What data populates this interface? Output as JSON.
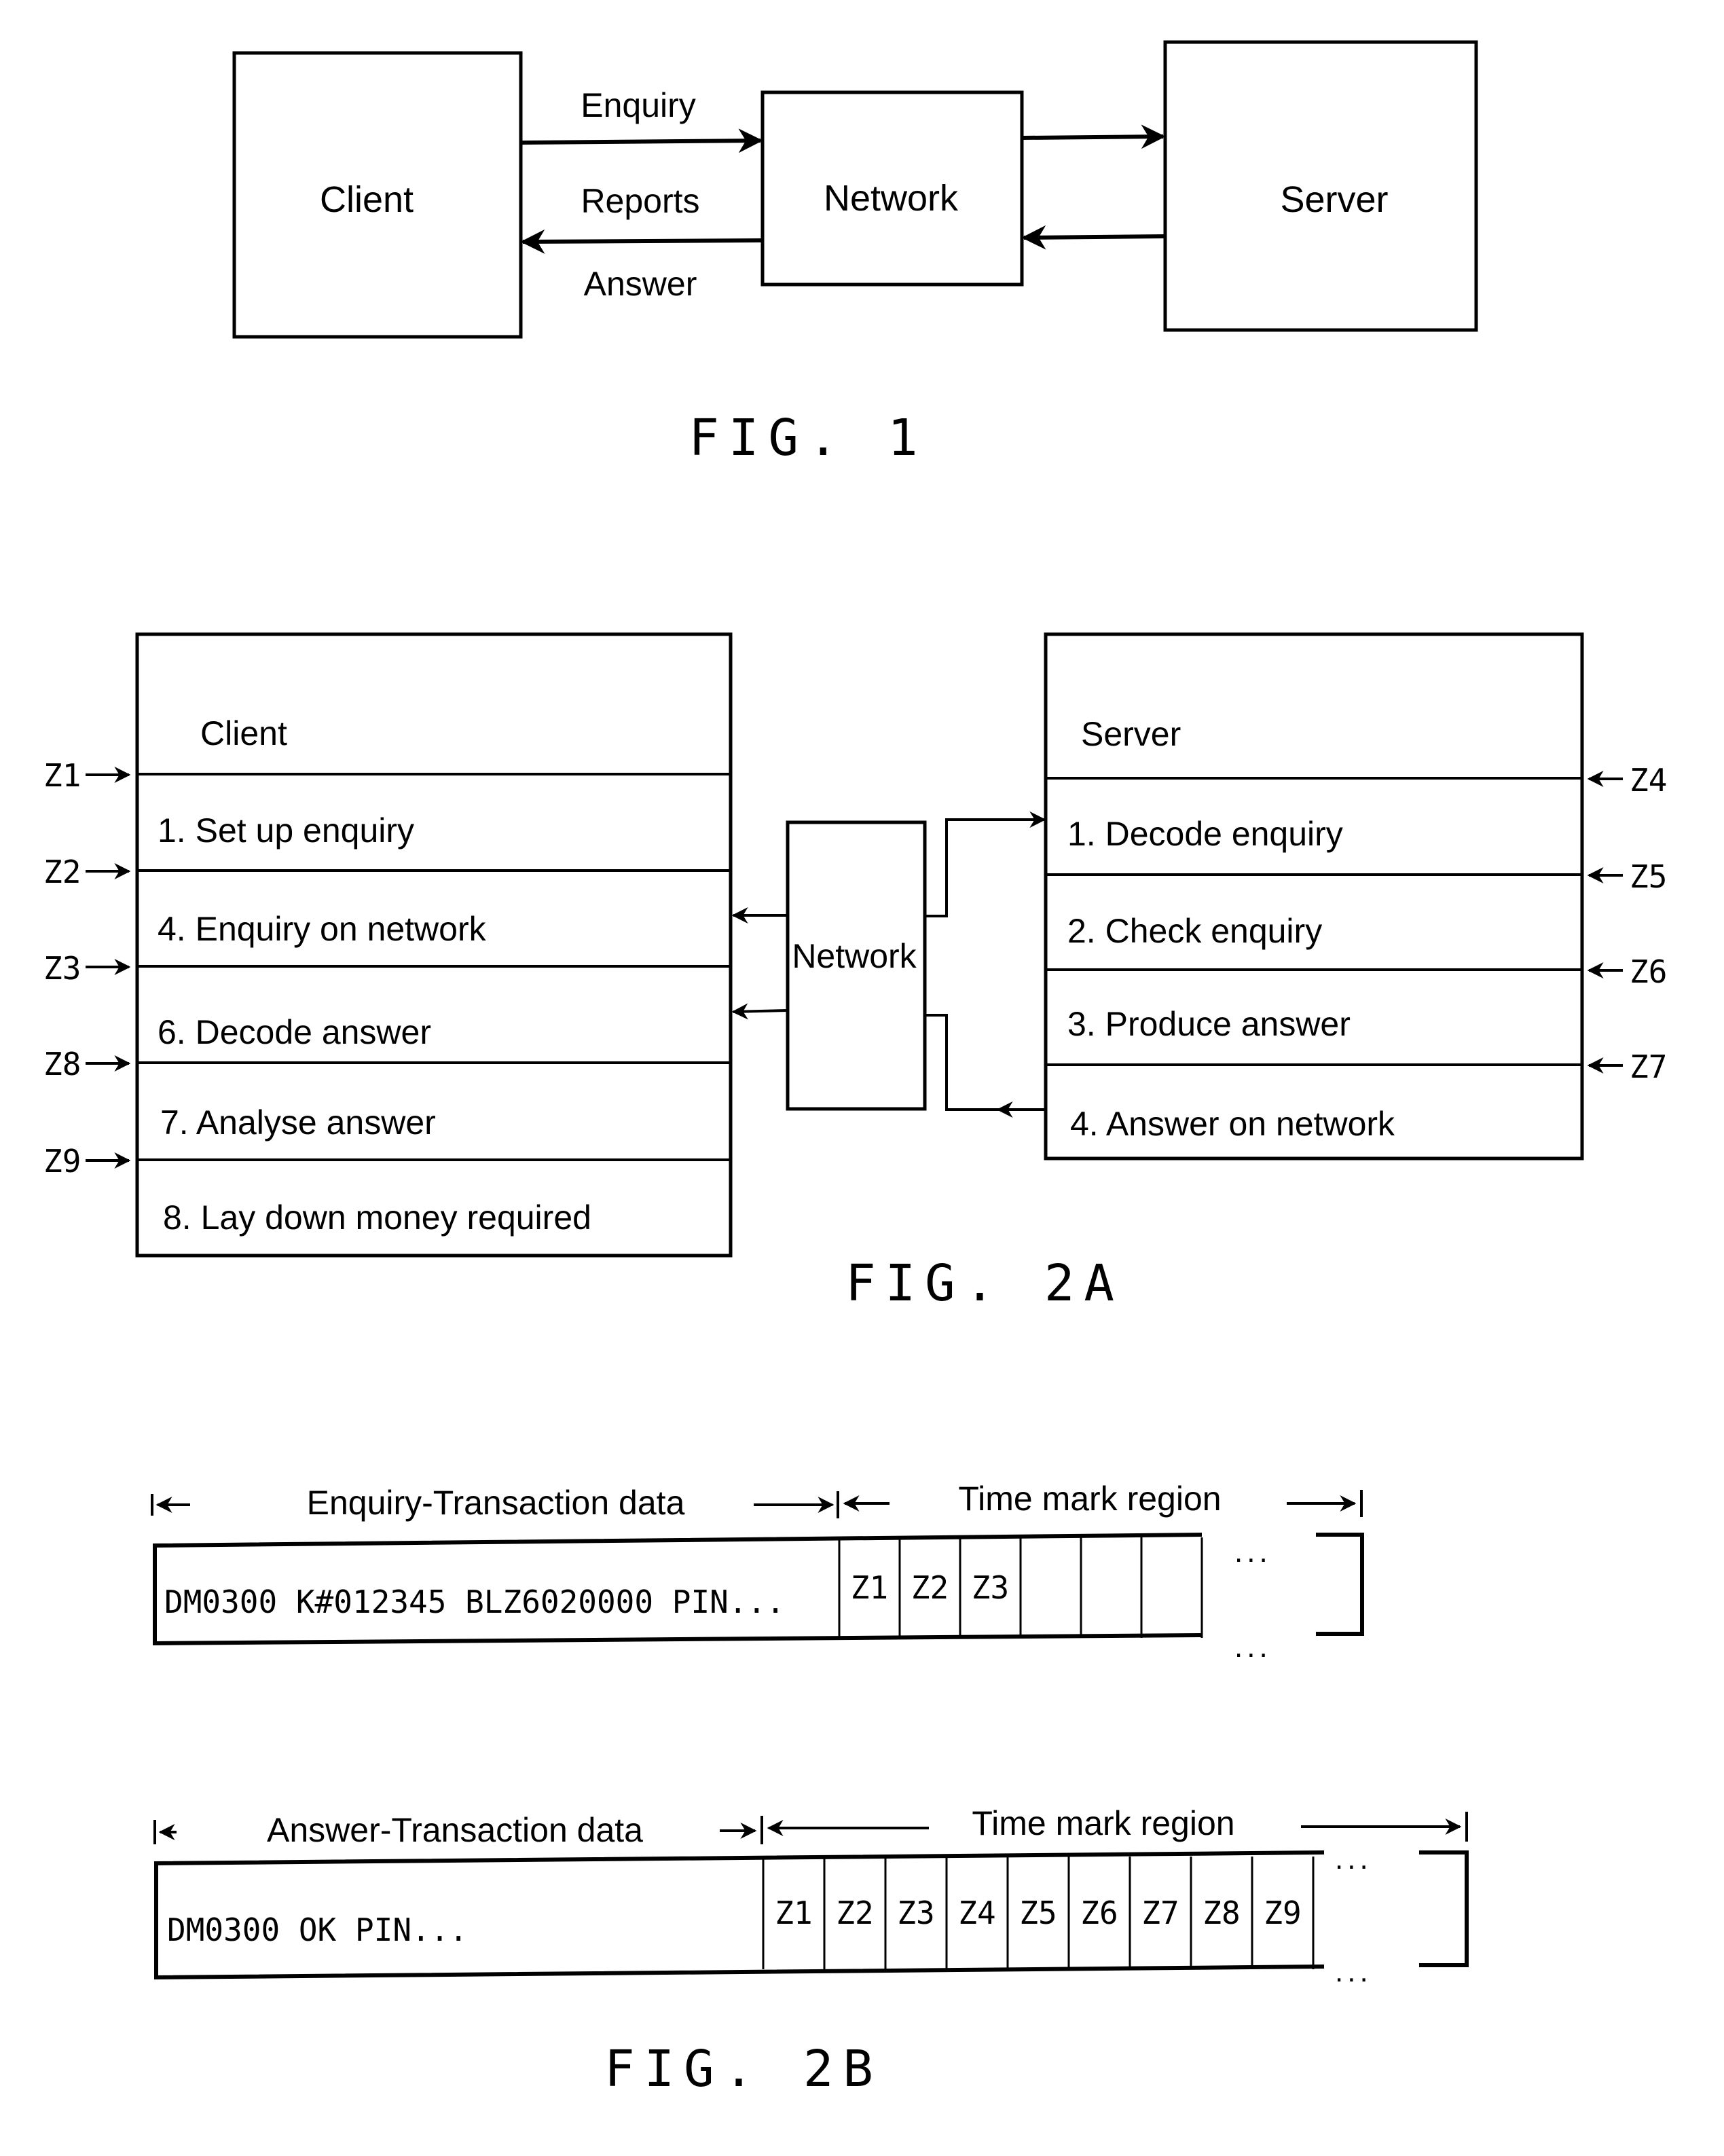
{
  "fig1": {
    "caption": "FIG. 1",
    "client_label": "Client",
    "network_label": "Network",
    "server_label": "Server",
    "arrow_labels": {
      "enquiry": "Enquiry",
      "reports": "Reports",
      "answer": "Answer"
    }
  },
  "fig2a": {
    "caption": "FIG. 2A",
    "client": {
      "title": "Client",
      "steps": [
        "1. Set up enquiry",
        "4. Enquiry on network",
        "6. Decode answer",
        "7. Analyse answer",
        "8. Lay down money required"
      ],
      "time_marks": [
        "Z1",
        "Z2",
        "Z3",
        "Z8",
        "Z9"
      ]
    },
    "network_label": "Network",
    "server": {
      "title": "Server",
      "steps": [
        "1. Decode enquiry",
        "2. Check enquiry",
        "3. Produce answer",
        "4. Answer on network"
      ],
      "time_marks": [
        "Z4",
        "Z5",
        "Z6",
        "Z7"
      ]
    }
  },
  "fig2b": {
    "caption": "FIG. 2B",
    "enquiry_record": {
      "data_label": "Enquiry-Transaction data",
      "region_label": "Time mark region",
      "data_value": "DM0300 K#012345 BLZ6020000 PIN...",
      "cells": [
        "Z1",
        "Z2",
        "Z3",
        "",
        "",
        ""
      ],
      "continuation": "..."
    },
    "answer_record": {
      "data_label": "Answer-Transaction data",
      "region_label": "Time mark region",
      "data_value": "DM0300 OK PIN...",
      "cells": [
        "Z1",
        "Z2",
        "Z3",
        "Z4",
        "Z5",
        "Z6",
        "Z7",
        "Z8",
        "Z9"
      ],
      "continuation": "..."
    }
  }
}
